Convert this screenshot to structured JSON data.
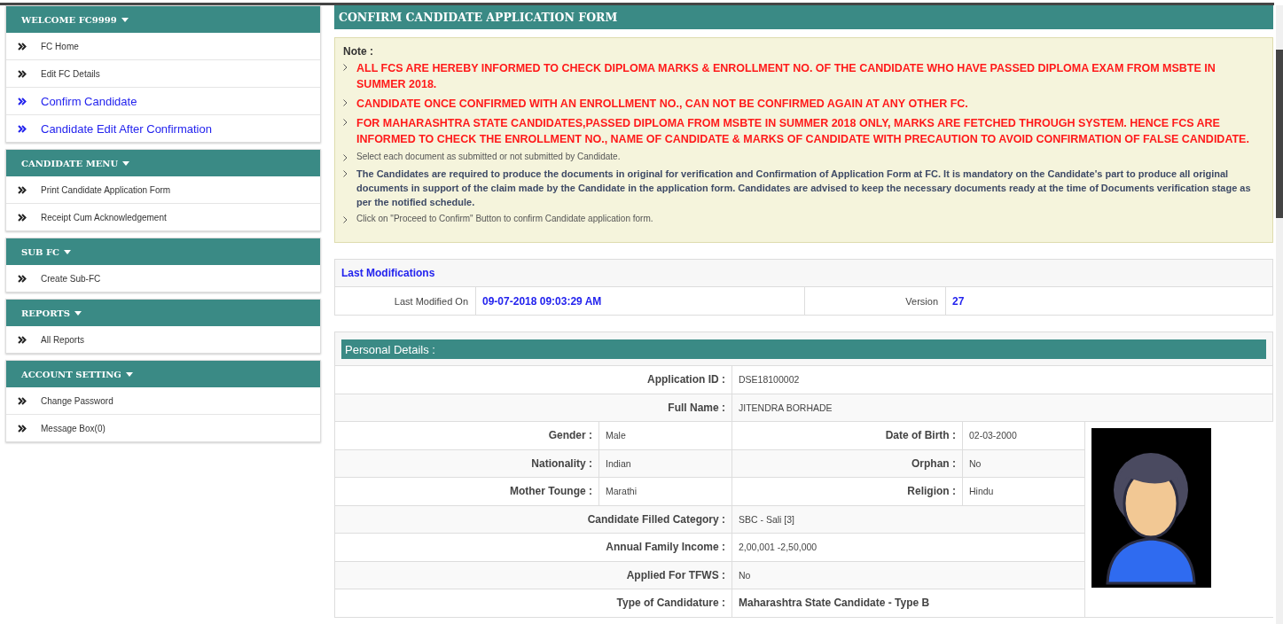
{
  "sidebar": {
    "sections": [
      {
        "title": "WELCOME FC9999",
        "items": [
          {
            "label": "FC Home",
            "kind": "normal"
          },
          {
            "label": "Edit FC Details",
            "kind": "normal"
          },
          {
            "label": "Confirm Candidate",
            "kind": "primary"
          },
          {
            "label": "Candidate Edit After Confirmation",
            "kind": "primary"
          }
        ]
      },
      {
        "title": "CANDIDATE MENU",
        "items": [
          {
            "label": "Print Candidate Application Form",
            "kind": "normal"
          },
          {
            "label": "Receipt Cum Acknowledgement",
            "kind": "normal"
          }
        ]
      },
      {
        "title": "SUB FC",
        "items": [
          {
            "label": "Create Sub-FC",
            "kind": "normal"
          }
        ]
      },
      {
        "title": "REPORTS",
        "items": [
          {
            "label": "All Reports",
            "kind": "normal"
          }
        ]
      },
      {
        "title": "ACCOUNT SETTING",
        "items": [
          {
            "label": "Change Password",
            "kind": "normal"
          },
          {
            "label": "Message Box(0)",
            "kind": "normal"
          }
        ]
      }
    ]
  },
  "page_title": "CONFIRM CANDIDATE APPLICATION FORM",
  "note": {
    "title": "Note :",
    "items": [
      {
        "kind": "alert",
        "text": "ALL FCS ARE HEREBY INFORMED TO CHECK DIPLOMA MARKS & ENROLLMENT NO. OF THE CANDIDATE WHO HAVE PASSED DIPLOMA EXAM FROM MSBTE IN SUMMER 2018."
      },
      {
        "kind": "alert",
        "text": "CANDIDATE ONCE CONFIRMED WITH AN ENROLLMENT NO., CAN NOT BE CONFIRMED AGAIN AT ANY OTHER FC."
      },
      {
        "kind": "alert",
        "text": "FOR MAHARASHTRA STATE CANDIDATES,PASSED DIPLOMA FROM MSBTE IN SUMMER 2018 ONLY, MARKS ARE FETCHED THROUGH SYSTEM. HENCE FCS ARE INFORMED TO CHECK THE ENROLLMENT NO., NAME OF CANDIDATE & MARKS OF CANDIDATE WITH PRECAUTION TO AVOID CONFIRMATION OF FALSE CANDIDATE."
      },
      {
        "kind": "info",
        "text": "Select each document as submitted or not submitted by Candidate."
      },
      {
        "kind": "strong",
        "text": "The Candidates are required to produce the documents in original for verification and Confirmation of Application Form at FC. It is mandatory on the Candidate's part to produce all original documents in support of the claim made by the Candidate in the application form. Candidates are advised to keep the necessary documents ready at the time of Documents verification stage as per the notified schedule."
      },
      {
        "kind": "info",
        "text": "Click on \"Proceed to Confirm\" Button to confirm Candidate application form."
      }
    ]
  },
  "last_modifications": {
    "title": "Last Modifications",
    "fields": [
      {
        "label": "Last Modified On",
        "value": "09-07-2018 09:03:29 AM"
      },
      {
        "label": "Version",
        "value": "27"
      }
    ]
  },
  "personal_details": {
    "title": "Personal Details :",
    "rows": [
      {
        "kind": "full",
        "fields": [
          {
            "label": "Application ID :",
            "value": "DSE18100002",
            "emphasis": false
          }
        ]
      },
      {
        "kind": "full",
        "fields": [
          {
            "label": "Full Name :",
            "value": "JITENDRA BORHADE",
            "emphasis": false
          }
        ]
      },
      {
        "kind": "pair",
        "fields": [
          {
            "label": "Gender :",
            "value": "Male",
            "emphasis": false
          },
          {
            "label": "Date of Birth :",
            "value": "02-03-2000",
            "emphasis": false
          }
        ]
      },
      {
        "kind": "pair",
        "fields": [
          {
            "label": "Nationality :",
            "value": "Indian",
            "emphasis": false
          },
          {
            "label": "Orphan :",
            "value": "No",
            "emphasis": false
          }
        ]
      },
      {
        "kind": "pair",
        "fields": [
          {
            "label": "Mother Tounge :",
            "value": "Marathi",
            "emphasis": false
          },
          {
            "label": "Religion :",
            "value": "Hindu",
            "emphasis": false
          }
        ]
      },
      {
        "kind": "single",
        "fields": [
          {
            "label": "Candidate Filled Category :",
            "value": "SBC - Sali [3]",
            "emphasis": false
          }
        ]
      },
      {
        "kind": "single",
        "fields": [
          {
            "label": "Annual Family Income :",
            "value": "2,00,001 -2,50,000",
            "emphasis": false
          }
        ]
      },
      {
        "kind": "single",
        "fields": [
          {
            "label": "Applied For TFWS :",
            "value": "No",
            "emphasis": false
          }
        ]
      },
      {
        "kind": "single",
        "fields": [
          {
            "label": "Type of Candidature :",
            "value": "Maharashtra State Candidate - Type B",
            "emphasis": true
          }
        ]
      }
    ]
  }
}
